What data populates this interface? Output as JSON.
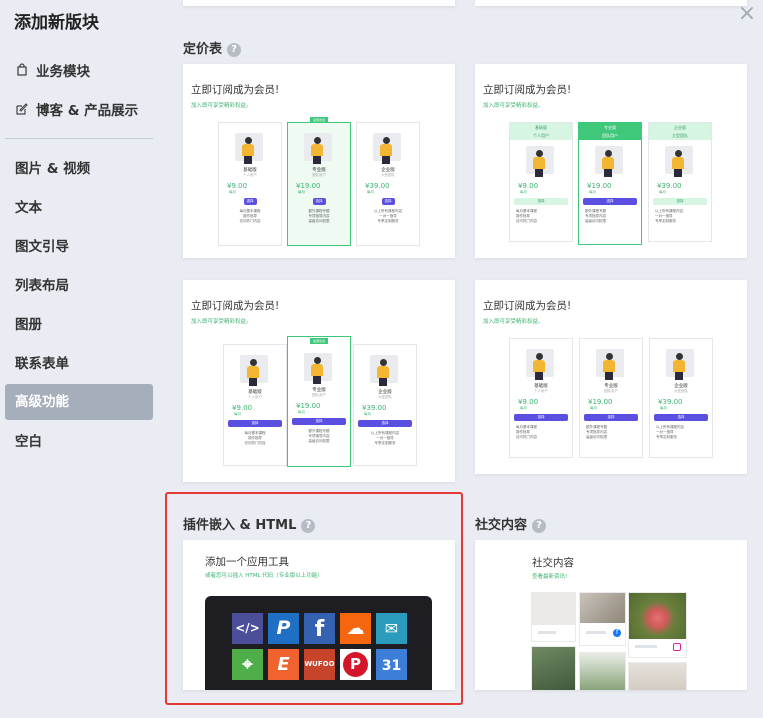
{
  "sidebar": {
    "title": "添加新版块",
    "items": [
      {
        "label": "业务模块",
        "icon": "shopping-bag-icon"
      },
      {
        "label": "博客 & 产品展示",
        "icon": "edit-icon"
      },
      {
        "label": "图片 & 视频"
      },
      {
        "label": "文本"
      },
      {
        "label": "图文引导"
      },
      {
        "label": "列表布局"
      },
      {
        "label": "图册"
      },
      {
        "label": "联系表单"
      },
      {
        "label": "高级功能",
        "active": true
      },
      {
        "label": "空白"
      }
    ]
  },
  "close_icon": "×",
  "sections": {
    "pricing": {
      "title": "定价表",
      "help": "?"
    },
    "embed": {
      "title": "插件嵌入 & HTML",
      "help": "?"
    },
    "social": {
      "title": "社交内容",
      "help": "?"
    }
  },
  "pricing_card": {
    "title": "立即订阅成为会员!",
    "subtitle": "加入即可享受精彩权益。",
    "badge": "最受欢迎",
    "plans": [
      {
        "name": "基础版",
        "small": "个人用户",
        "price": "¥9.00",
        "unit": "每月",
        "button": "选择",
        "features": [
          "每月基本课程",
          "操作指导",
          "访问热门内容"
        ]
      },
      {
        "name": "专业版",
        "small": "团队用户",
        "price": "¥19.00",
        "unit": "每月",
        "button": "选择",
        "features": [
          "额外课程专题",
          "专项指导内容",
          "高级访问权限"
        ]
      },
      {
        "name": "企业版",
        "small": "大型团队",
        "price": "¥39.00",
        "unit": "每月",
        "button": "选择",
        "features": [
          "以上所有课程内容",
          "一对一指导",
          "专享定制服务"
        ]
      }
    ]
  },
  "embed_card": {
    "title": "添加一个应用工具",
    "subtitle": "或者您可以插入 HTML 代码（专业版以上功能）",
    "apps": [
      {
        "name": "html-code",
        "glyph": "</>",
        "color": "#4b4f9a"
      },
      {
        "name": "paypal",
        "glyph": "P",
        "color": "#1f6fc5"
      },
      {
        "name": "facebook",
        "glyph": "f",
        "color": "#3462b0"
      },
      {
        "name": "soundcloud",
        "glyph": "☁",
        "color": "#f5670f"
      },
      {
        "name": "mailchimp",
        "glyph": "✉",
        "color": "#2b9bbd"
      },
      {
        "name": "google-maps",
        "glyph": "⌖",
        "color": "#4fae4a"
      },
      {
        "name": "eventbrite",
        "glyph": "E",
        "color": "#f0632f"
      },
      {
        "name": "wufoo",
        "glyph": "WUFOO",
        "color": "#c7442a"
      },
      {
        "name": "pinterest",
        "glyph": "P",
        "color": "#d3162c"
      },
      {
        "name": "calendar",
        "glyph": "31",
        "color": "#3d7fd8"
      }
    ]
  },
  "social_card": {
    "title": "社交内容",
    "subtitle": "查看最新资讯!"
  },
  "colors": {
    "accent_green": "#3cb371",
    "button_purple": "#5a4fe0",
    "selection_red": "#e53935",
    "sidebar_active": "#a7aebb"
  }
}
